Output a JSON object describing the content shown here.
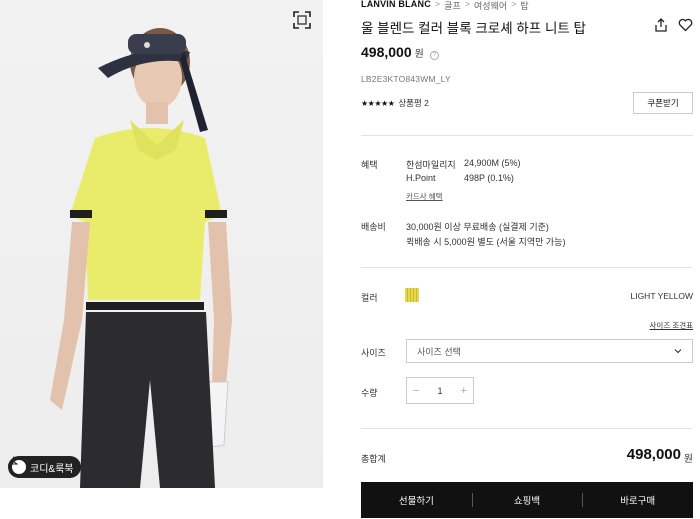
{
  "breadcrumb": {
    "brand": "LANVIN BLANC",
    "items": [
      "골프",
      "여성웨어",
      "탑"
    ]
  },
  "product": {
    "title": "울 블렌드 컬러 블록 크로셰 하프 니트 탑",
    "price": "498,000",
    "currency": "원",
    "sku": "LB2E3KTO843WM_LY",
    "stars": "★★★★★",
    "review_label": "상품평 2"
  },
  "coupon_button": "쿠폰받기",
  "benefits": {
    "label": "혜택",
    "items": [
      {
        "name": "한섬마일리지",
        "value": "24,900M (5%)"
      },
      {
        "name": "H.Point",
        "value": "498P (0.1%)"
      }
    ],
    "card_link": "카드사 혜택"
  },
  "shipping": {
    "label": "배송비",
    "lines": [
      "30,000원 이상 무료배송 (실결제 기준)",
      "퀵배송 시 5,000원 별도 (서울 지역만 가능)"
    ]
  },
  "color": {
    "label": "컬러",
    "selected": "LIGHT YELLOW",
    "swatch_color": "#e6d84a"
  },
  "size": {
    "guide_link": "사이즈 조견표",
    "label": "사이즈",
    "placeholder": "사이즈 선택"
  },
  "quantity": {
    "label": "수량",
    "minus": "−",
    "value": "1",
    "plus": "+"
  },
  "total": {
    "label": "총합계",
    "price": "498,000",
    "currency": "원"
  },
  "buttons": {
    "gift": "선물하기",
    "cart": "쇼핑백",
    "buy": "바로구매"
  },
  "image": {
    "badge_label": "코디&룩북",
    "top_color": "#e9ec6a"
  }
}
